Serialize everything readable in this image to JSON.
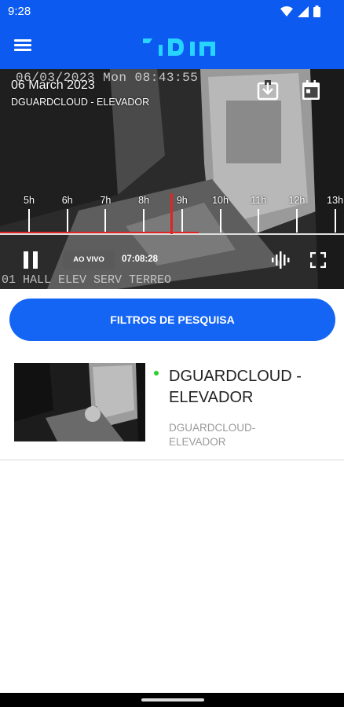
{
  "status_bar": {
    "time": "9:28",
    "icons": [
      "wifi-icon",
      "signal-icon",
      "battery-icon"
    ]
  },
  "app_bar": {
    "menu_icon": "hamburger-menu-icon",
    "logo": "dguard-logo",
    "brand_color": "#0c5af0"
  },
  "player": {
    "osd_timestamp": "06/03/2023 Mon 08:43:55",
    "osd_camera": "01 HALL ELEV SERV TERREO",
    "date": "06 March 2023",
    "camera_name": "DGUARDCLOUD - ELEVADOR",
    "download_icon": "download-icon",
    "calendar_icon": "calendar-icon",
    "timeline": {
      "ticks": [
        "5h",
        "6h",
        "7h",
        "8h",
        "9h",
        "10h",
        "11h",
        "12h",
        "13h"
      ],
      "cursor_color": "#e02424"
    },
    "live_label": "AO VIVO",
    "clock": "07:08:28",
    "audio_icon": "audio-wave-icon",
    "fullscreen_icon": "fullscreen-icon"
  },
  "filters": {
    "label": "FILTROS DE PESQUISA",
    "color": "#1565f5"
  },
  "cameras": [
    {
      "title": "DGUARDCLOUD - ELEVADOR",
      "subtitle": "DGUARDCLOUD-ELEVADOR",
      "status_color": "#2bd12b"
    }
  ]
}
